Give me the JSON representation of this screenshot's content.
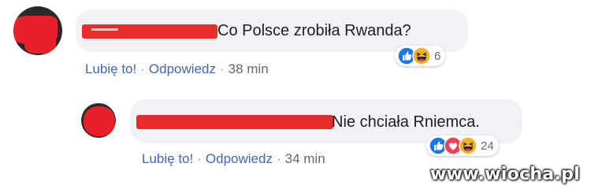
{
  "comments": [
    {
      "text": "Co Polsce zrobiła Rwanda?",
      "actions": {
        "like": "Lubię to!",
        "sep1": "·",
        "reply": "Odpowiedz",
        "sep2": "·",
        "time": "38 min"
      },
      "reaction_count": "6",
      "reaction_icons": [
        "like-icon",
        "haha-icon"
      ]
    },
    {
      "text": "Nie chciała Rniemca.",
      "actions": {
        "like": "Lubię to!",
        "sep1": "·",
        "reply": "Odpowiedz",
        "sep2": "·",
        "time": "34 min"
      },
      "reaction_count": "24",
      "reaction_icons": [
        "like-icon",
        "love-icon",
        "haha-icon"
      ]
    }
  ],
  "watermark": "www.wiocha.pl",
  "colors": {
    "like": "#1877f2",
    "love": "#f33e58",
    "haha": "#f7b125",
    "redaction": "#e8202a",
    "bubble": "#f0f2f5"
  }
}
